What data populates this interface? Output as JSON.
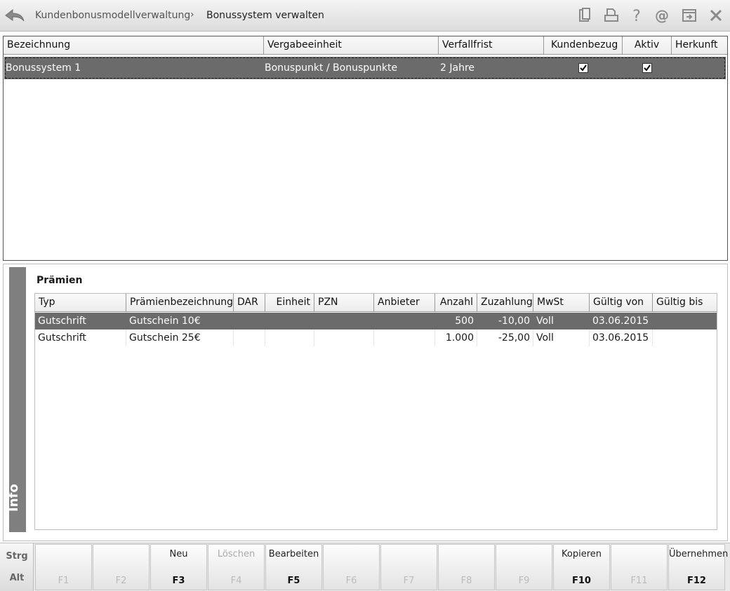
{
  "header": {
    "breadcrumb_parent": "Kundenbonusmodellverwaltung",
    "breadcrumb_separator": "›",
    "breadcrumb_current": "Bonussystem verwalten",
    "icons": [
      "back-arrow-icon",
      "clipboard-icon",
      "printer-icon",
      "help-icon",
      "at-icon",
      "window-export-icon",
      "close-icon"
    ]
  },
  "bonus_table": {
    "columns": [
      "Bezeichnung",
      "Vergabeeinheit",
      "Verfallfrist",
      "Kundenbezug",
      "Aktiv",
      "Herkunft"
    ],
    "rows": [
      {
        "bezeichnung": "Bonussystem 1",
        "vergabeeinheit": "Bonuspunkt / Bonuspunkte",
        "verfallfrist": "2 Jahre",
        "kundenbezug": true,
        "aktiv": true,
        "herkunft": ""
      }
    ]
  },
  "info_panel": {
    "side_label": "Info",
    "section_title": "Prämien",
    "columns": [
      "Typ",
      "Prämienbezeichnung",
      "DAR",
      "Einheit",
      "PZN",
      "Anbieter",
      "Anzahl",
      "Zuzahlung",
      "MwSt",
      "Gültig von",
      "Gültig bis"
    ],
    "rows": [
      {
        "typ": "Gutschrift",
        "bezeichnung": "Gutschein 10€",
        "dar": "",
        "einheit": "",
        "pzn": "",
        "anbieter": "",
        "anzahl": "500",
        "zuzahlung": "-10,00",
        "mwst": "Voll",
        "gueltig_von": "03.06.2015",
        "gueltig_bis": ""
      },
      {
        "typ": "Gutschrift",
        "bezeichnung": "Gutschein 25€",
        "dar": "",
        "einheit": "",
        "pzn": "",
        "anbieter": "",
        "anzahl": "1.000",
        "zuzahlung": "-25,00",
        "mwst": "Voll",
        "gueltig_von": "03.06.2015",
        "gueltig_bis": ""
      }
    ]
  },
  "function_bar": {
    "modifier_strg": "Strg",
    "modifier_alt": "Alt",
    "keys": [
      {
        "key": "F1",
        "label": "",
        "enabled": false
      },
      {
        "key": "F2",
        "label": "",
        "enabled": false
      },
      {
        "key": "F3",
        "label": "Neu",
        "enabled": true
      },
      {
        "key": "F4",
        "label": "Löschen",
        "enabled": false
      },
      {
        "key": "F5",
        "label": "Bearbeiten",
        "enabled": true
      },
      {
        "key": "F6",
        "label": "",
        "enabled": false
      },
      {
        "key": "F7",
        "label": "",
        "enabled": false
      },
      {
        "key": "F8",
        "label": "",
        "enabled": false
      },
      {
        "key": "F9",
        "label": "",
        "enabled": false
      },
      {
        "key": "F10",
        "label": "Kopieren",
        "enabled": true
      },
      {
        "key": "F11",
        "label": "",
        "enabled": false
      },
      {
        "key": "F12",
        "label": "Übernehmen",
        "enabled": true
      }
    ]
  },
  "colors": {
    "selection": "#6b6b6b",
    "info_bar": "#7f7f7f"
  }
}
